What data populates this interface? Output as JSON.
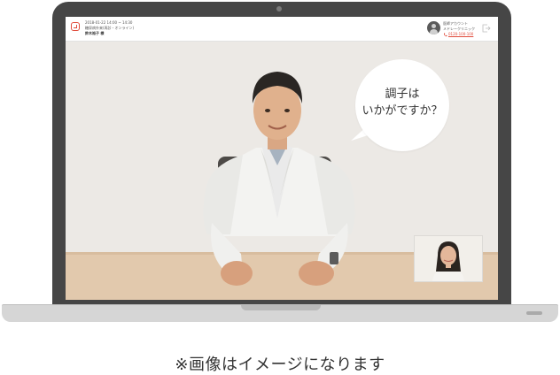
{
  "header": {
    "datetime": "2018-01-22 14:00 ~ 14:30",
    "appointment": "糖尿病外来(再診・オンライン)",
    "patient_name": "鈴木裕子 様",
    "account_label": "医師アカウント",
    "clinic_name": "メドレークリニック",
    "phone": "0120-100-100"
  },
  "video": {
    "speech_line1": "調子は",
    "speech_line2": "いかがですか？"
  },
  "caption": "※画像はイメージになります",
  "colors": {
    "laptop_bezel": "#464646",
    "laptop_base": "#d6d6d6",
    "brand_red": "#e04b3c",
    "caption_text": "#333333"
  },
  "icons": [
    "camera-icon",
    "app-logo-icon",
    "user-avatar-icon",
    "phone-icon",
    "logout-icon"
  ]
}
